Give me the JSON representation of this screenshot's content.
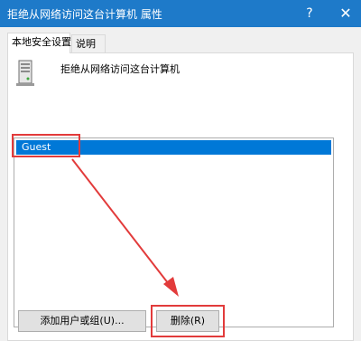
{
  "window": {
    "title": "拒绝从网络访问这台计算机 属性",
    "help_glyph": "?",
    "close_glyph": "✕"
  },
  "tabs": [
    {
      "label": "本地安全设置",
      "active": true
    },
    {
      "label": "说明",
      "active": false
    }
  ],
  "policy": {
    "icon": "server-icon",
    "name": "拒绝从网络访问这台计算机"
  },
  "accounts": {
    "items": [
      "Guest"
    ],
    "selected": "Guest"
  },
  "buttons": {
    "add_label": "添加用户或组(U)...",
    "remove_label": "删除(R)"
  },
  "annotation": {
    "color": "#e23b3b"
  }
}
